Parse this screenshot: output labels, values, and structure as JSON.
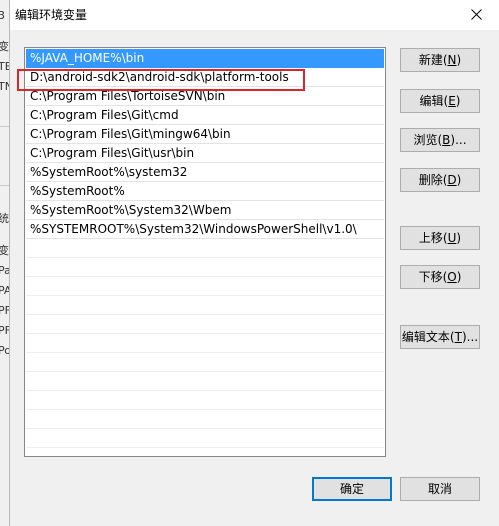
{
  "dialog": {
    "title": "编辑环境变量",
    "close_icon": "close-icon"
  },
  "background_window": {
    "glyphs": [
      "3",
      "变",
      "TE",
      "TN",
      "统",
      "变",
      "Pa",
      "PA",
      "PF",
      "PF",
      "Po"
    ]
  },
  "paths": [
    "%JAVA_HOME%\\bin",
    "D:\\android-sdk2\\android-sdk\\platform-tools",
    "C:\\Program Files\\TortoiseSVN\\bin",
    "C:\\Program Files\\Git\\cmd",
    "C:\\Program Files\\Git\\mingw64\\bin",
    "C:\\Program Files\\Git\\usr\\bin",
    "%SystemRoot%\\system32",
    "%SystemRoot%",
    "%SystemRoot%\\System32\\Wbem",
    "%SYSTEMROOT%\\System32\\WindowsPowerShell\\v1.0\\"
  ],
  "selected_index": 0,
  "highlighted_index": 1,
  "highlight_color": "#d9262b",
  "selection_color": "#3399ff",
  "buttons": {
    "new": {
      "label": "新建(",
      "mnemonic": "N",
      "close": ")"
    },
    "edit": {
      "label": "编辑(",
      "mnemonic": "E",
      "close": ")"
    },
    "browse": {
      "label": "浏览(",
      "mnemonic": "B",
      "close": ")..."
    },
    "delete": {
      "label": "删除(",
      "mnemonic": "D",
      "close": ")"
    },
    "move_up": {
      "label": "上移(",
      "mnemonic": "U",
      "close": ")"
    },
    "move_down": {
      "label": "下移(",
      "mnemonic": "O",
      "close": ")"
    },
    "edit_text": {
      "label": "编辑文本(",
      "mnemonic": "T",
      "close": ")..."
    },
    "ok": {
      "label": "确定"
    },
    "cancel": {
      "label": "取消"
    }
  }
}
